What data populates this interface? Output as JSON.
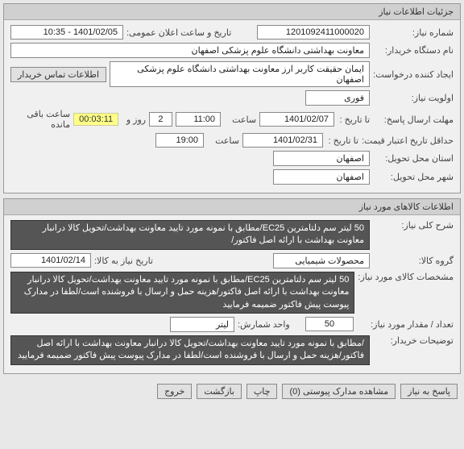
{
  "section1": {
    "title": "جزئیات اطلاعات نیاز",
    "need_number_label": "شماره نیاز:",
    "need_number": "1201092411000020",
    "announce_label": "تاریخ و ساعت اعلان عمومی:",
    "announce_value": "1401/02/05 - 10:35",
    "buyer_org_label": "نام دستگاه خریدار:",
    "buyer_org": "معاونت بهداشتی دانشگاه علوم پزشکی اصفهان",
    "requester_label": "ایجاد کننده درخواست:",
    "requester": "ایمان حقیقت کاربر ارز معاونت بهداشتی دانشگاه علوم پزشکی اصفهان",
    "contact_btn": "اطلاعات تماس خریدار",
    "priority_label": "اولویت نیاز:",
    "priority": "فوری",
    "deadline_label": "مهلت ارسال پاسخ:",
    "to_date_lbl": "تا تاریخ :",
    "deadline_date": "1401/02/07",
    "time_lbl": "ساعت",
    "deadline_time": "11:00",
    "days_lbl": "روز و",
    "days_remain": "2",
    "hours_remain": "00:03:11",
    "remain_lbl": "ساعت باقی مانده",
    "price_valid_label": "حداقل تاریخ اعتبار قیمت:",
    "price_date": "1401/02/31",
    "price_time": "19:00",
    "province_label": "استان محل تحویل:",
    "province": "اصفهان",
    "city_label": "شهر محل تحویل:",
    "city": "اصفهان"
  },
  "section2": {
    "title": "اطلاعات کالاهای مورد نیاز",
    "desc_label": "شرح کلی نیاز:",
    "desc": "50 لیتر سم دلتامترین EC25/مطابق با نمونه مورد تایید معاونت بهداشت/تحویل کالا درانبار معاونت بهداشت با ارائه اصل فاکتور/",
    "group_label": "گروه کالا:",
    "group": "محصولات شیمیایی",
    "need_date_label": "تاریخ نیاز به کالا:",
    "need_date": "1401/02/14",
    "spec_label": "مشخصات کالای مورد نیاز:",
    "spec": "50 لیتر سم دلتامترین EC25/مطابق با نمونه مورد تایید معاونت بهداشت/تحویل کالا درانبار معاونت بهداشت با ارائه اصل فاکتور/هزینه حمل و ارسال با فروشنده است/لطفا در مدارک پیوست پیش فاکتور ضمیمه فرمایید",
    "qty_label": "تعداد / مقدار مورد نیاز:",
    "qty": "50",
    "unit_label": "واحد شمارش:",
    "unit": "لیتر",
    "notes_label": "توضیحات خریدار:",
    "notes": "/مطابق با نمونه مورد تایید معاونت بهداشت/تحویل کالا درانبار معاونت بهداشت با ارائه اصل فاکتور/هزینه حمل و ارسال با فروشنده است/لطفا در مدارک پیوست پیش فاکتور ضمیمه فرمایید"
  },
  "footer": {
    "respond": "پاسخ به نیاز",
    "attachments": "مشاهده مدارک پیوستی (0)",
    "print": "چاپ",
    "back": "بازگشت",
    "exit": "خروج"
  }
}
